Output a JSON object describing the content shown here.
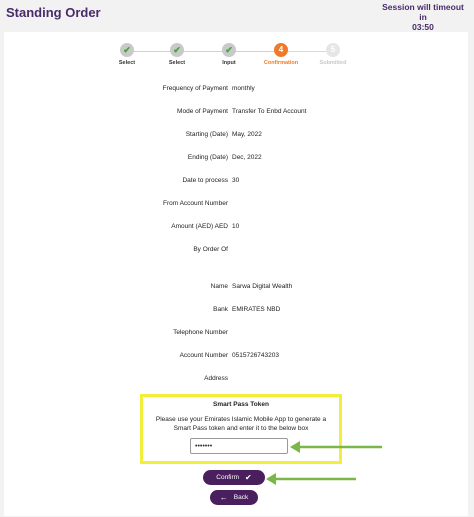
{
  "header": {
    "title": "Standing Order",
    "session_line1": "Session will timeout in",
    "session_line2": "03:50"
  },
  "stepper": {
    "steps": [
      {
        "label": "Select",
        "state": "done"
      },
      {
        "label": "Select",
        "state": "done"
      },
      {
        "label": "Input",
        "state": "done"
      },
      {
        "label": "Confirmation",
        "state": "active",
        "number": "4"
      },
      {
        "label": "Submitted",
        "state": "pending",
        "number": "5"
      }
    ]
  },
  "details": [
    {
      "label": "Frequency of Payment",
      "value": "monthly"
    },
    {
      "label": "Mode of Payment",
      "value": "Transfer To Enbd Account"
    },
    {
      "label": "Starting (Date)",
      "value": "May, 2022"
    },
    {
      "label": "Ending (Date)",
      "value": "Dec, 2022"
    },
    {
      "label": "Date to process",
      "value": "30"
    },
    {
      "label": "From Account Number",
      "value": ""
    },
    {
      "label": "Amount (AED) AED",
      "value": "10"
    },
    {
      "label": "By Order Of",
      "value": ""
    },
    {
      "label": "Name",
      "value": "Sarwa Digital Wealth"
    },
    {
      "label": "Bank",
      "value": "EMIRATES NBD"
    },
    {
      "label": "Telephone Number",
      "value": ""
    },
    {
      "label": "Account Number",
      "value": "0515726743203"
    },
    {
      "label": "Address",
      "value": ""
    }
  ],
  "token": {
    "title": "Smart Pass Token",
    "description": "Please use your Emirates Islamic Mobile App to generate a Smart Pass token and enter it to the below box",
    "value": "•••••••"
  },
  "buttons": {
    "confirm": "Confirm",
    "back": "Back"
  },
  "colors": {
    "brand": "#4a1f5e",
    "active_step": "#ef7a2a",
    "highlight": "#f3ee3a",
    "annotation_arrow": "#7ab648"
  }
}
